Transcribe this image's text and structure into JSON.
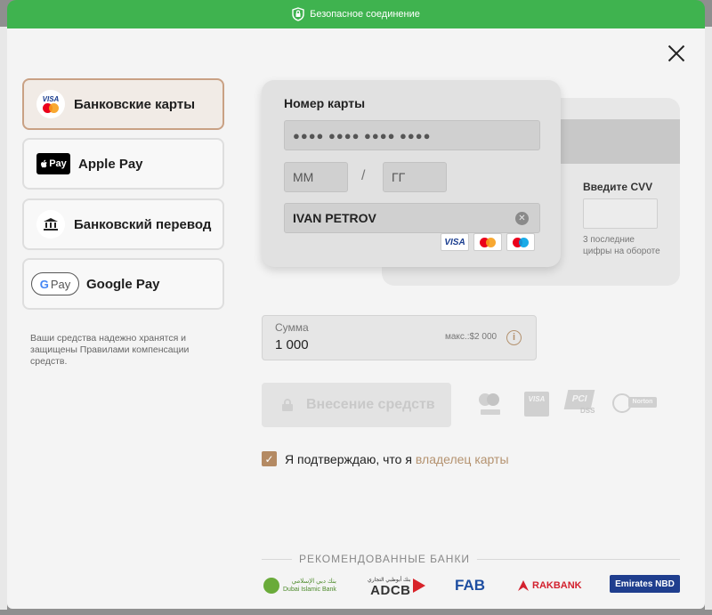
{
  "secure_bar": {
    "text": "Безопасное соединение"
  },
  "methods": [
    {
      "label": "Банковские карты",
      "icon": "visa-mastercard-icon",
      "active": true
    },
    {
      "label": "Apple Pay",
      "icon": "apple-pay-icon",
      "badge": "Pay"
    },
    {
      "label": "Банковский перевод",
      "icon": "bank-building-icon"
    },
    {
      "label": "Google Pay",
      "icon": "google-pay-icon",
      "badge": "Pay"
    }
  ],
  "safe_note": "Ваши средства надежно хранятся и защищены Правилами компенсации средств.",
  "card": {
    "title": "Номер карты",
    "number_value": "●●●● ●●●● ●●●● ●●●●",
    "month_placeholder": "ММ",
    "separator": "/",
    "year_placeholder": "ГГ",
    "holder_value": "IVAN PETROV",
    "brands": [
      "VISA",
      "mastercard",
      "maestro"
    ]
  },
  "cvv": {
    "label": "Введите CVV",
    "hint": "3 последние цифры на обороте"
  },
  "amount": {
    "label": "Сумма",
    "value": "1 000",
    "max": "макс.:$2 000"
  },
  "deposit_button": "Внесение средств",
  "security_logos": [
    "mastercard-securecode",
    "VISA",
    "PCI DSS",
    "Norton"
  ],
  "agreement": {
    "text": "Я подтверждаю, что я",
    "link": "владелец карты",
    "checked": true
  },
  "banks": {
    "title": "РЕКОМЕНДОВАННЫЕ БАНКИ",
    "items": [
      "Dubai Islamic Bank",
      "ADCB",
      "FAB",
      "RAKBANK",
      "Emirates NBD"
    ]
  },
  "colors": {
    "accent": "#b4926f",
    "secure": "#3fb34f",
    "active_border": "#c9a184"
  }
}
